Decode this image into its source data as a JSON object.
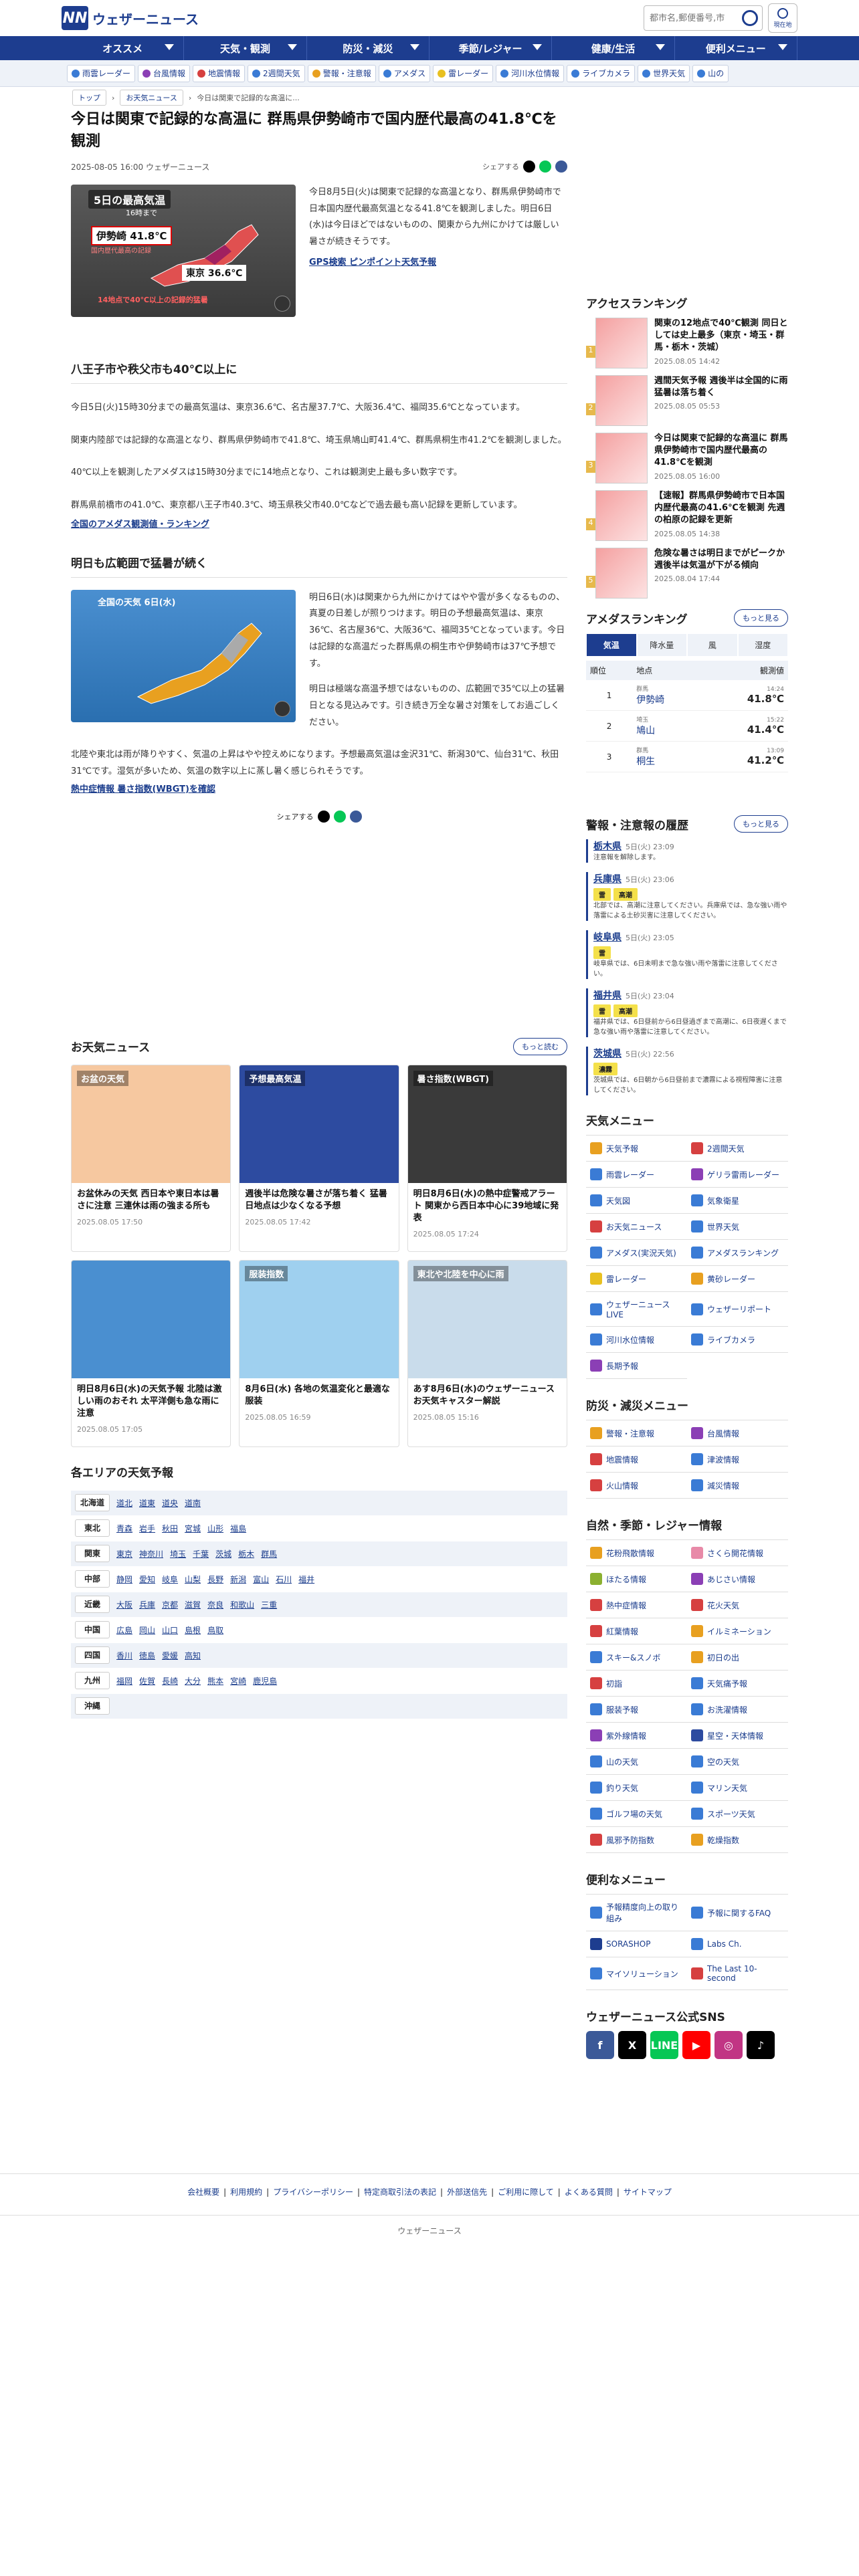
{
  "header": {
    "logo_mark": "NN",
    "logo_text": "ウェザーニュース",
    "search_placeholder": "都市名,郵便番号,市",
    "location_label": "現在地"
  },
  "gnav": [
    "オススメ",
    "天気・観測",
    "防災・減災",
    "季節/レジャー",
    "健康/生活",
    "便利メニュー"
  ],
  "subnav": [
    {
      "label": "雨雲レーダー",
      "color": "#3a7bd5"
    },
    {
      "label": "台風情報",
      "color": "#8b3fb5"
    },
    {
      "label": "地震情報",
      "color": "#d64040"
    },
    {
      "label": "2週間天気",
      "color": "#3a7bd5"
    },
    {
      "label": "警報・注意報",
      "color": "#e8a020"
    },
    {
      "label": "アメダス",
      "color": "#3a7bd5"
    },
    {
      "label": "雷レーダー",
      "color": "#e8c020"
    },
    {
      "label": "河川水位情報",
      "color": "#3a7bd5"
    },
    {
      "label": "ライブカメラ",
      "color": "#3a7bd5"
    },
    {
      "label": "世界天気",
      "color": "#3a7bd5"
    },
    {
      "label": "山の",
      "color": "#3a7bd5"
    }
  ],
  "breadcrumb": {
    "top": "トップ",
    "news": "お天気ニュース",
    "current": "今日は関東で記録的な高温に..."
  },
  "article": {
    "title": "今日は関東で記録的な高温に 群馬県伊勢崎市で国内歴代最高の41.8℃を観測",
    "date": "2025-08-05 16:00 ウェザーニュース",
    "share_label": "シェアする",
    "lead_image": {
      "heading": "5日の最高気温",
      "sub": "16時まで",
      "city": "伊勢崎 41.8℃",
      "note": "国内歴代最高の記録",
      "city2": "東京 36.6℃",
      "footer": "14地点で40℃以上の記録的猛暑"
    },
    "lead_text": "今日8月5日(火)は関東で記録的な高温となり、群馬県伊勢崎市で日本国内歴代最高気温となる41.8℃を観測しました。明日6日(水)は今日ほどではないものの、関東から九州にかけては厳しい暑さが続きそうです。",
    "gps_link": "GPS検索 ピンポイント天気予報",
    "h2_1": "八王子市や秩父市も40℃以上に",
    "p1": "今日5日(火)15時30分までの最高気温は、東京36.6℃、名古屋37.7℃、大阪36.4℃、福岡35.6℃となっています。",
    "p2": "関東内陸部では記録的な高温となり、群馬県伊勢崎市で41.8℃、埼玉県鳩山町41.4℃、群馬県桐生市41.2℃を観測しました。",
    "p3": "40℃以上を観測したアメダスは15時30分までに14地点となり、これは観測史上最も多い数字です。",
    "p4": "群馬県前橋市の41.0℃、東京都八王子市40.3℃、埼玉県秩父市40.0℃などで過去最も高い記録を更新しています。",
    "amedas_link": "全国のアメダス観測値・ランキング",
    "h2_2": "明日も広範囲で猛暑が続く",
    "image2": {
      "heading": "全国の天気 6日(水)"
    },
    "p5": "明日6日(水)は関東から九州にかけてはやや雲が多くなるものの、真夏の日差しが照りつけます。明日の予想最高気温は、東京36℃、名古屋36℃、大阪36℃、福岡35℃となっています。今日は記録的な高温だった群馬県の桐生市や伊勢崎市は37℃予想です。",
    "p6": "明日は極端な高温予想ではないものの、広範囲で35℃以上の猛暑日となる見込みです。引き続き万全な暑さ対策をしてお過ごしください。",
    "p7": "北陸や東北は雨が降りやすく、気温の上昇はやや控えめになります。予想最高気温は金沢31℃、新潟30℃、仙台31℃、秋田31℃です。湿気が多いため、気温の数字以上に蒸し暑く感じられそうです。",
    "wbgt_link": "熱中症情報 暑さ指数(WBGT)を確認"
  },
  "news_section": {
    "title": "お天気ニュース",
    "more": "もっと読む",
    "cards": [
      {
        "title": "お盆休みの天気 西日本や東日本は暑さに注意 三連休は雨の強まる所も",
        "date": "2025.08.05 17:50",
        "bg": "#f6c8a0",
        "img_label": "お盆の天気"
      },
      {
        "title": "週後半は危険な暑さが落ち着く 猛暑日地点は少なくなる予想",
        "date": "2025.08.05 17:42",
        "bg": "#2d4ba0",
        "img_label": "予想最高気温"
      },
      {
        "title": "明日8月6日(水)の熱中症警戒アラート 関東から西日本中心に39地域に発表",
        "date": "2025.08.05 17:24",
        "bg": "#3a3a3a",
        "img_label": "暑さ指数(WBGT)"
      },
      {
        "title": "明日8月6日(水)の天気予報 北陸は激しい雨のおそれ 太平洋側も急な雨に注意",
        "date": "2025.08.05 17:05",
        "bg": "#4a8fd0",
        "img_label": ""
      },
      {
        "title": "8月6日(水) 各地の気温変化と最適な服装",
        "date": "2025.08.05 16:59",
        "bg": "#9fd0ef",
        "img_label": "服装指数"
      },
      {
        "title": "あす8月6日(水)のウェザーニュース お天気キャスター解説",
        "date": "2025.08.05 15:16",
        "bg": "#c9dceb",
        "img_label": "東北や北陸を中心に雨"
      }
    ]
  },
  "area_section": {
    "title": "各エリアの天気予報",
    "rows": [
      {
        "region": "北海道",
        "prefs": [
          "道北",
          "道東",
          "道央",
          "道南"
        ]
      },
      {
        "region": "東北",
        "prefs": [
          "青森",
          "岩手",
          "秋田",
          "宮城",
          "山形",
          "福島"
        ]
      },
      {
        "region": "関東",
        "prefs": [
          "東京",
          "神奈川",
          "埼玉",
          "千葉",
          "茨城",
          "栃木",
          "群馬"
        ]
      },
      {
        "region": "中部",
        "prefs": [
          "静岡",
          "愛知",
          "岐阜",
          "山梨",
          "長野",
          "新潟",
          "富山",
          "石川",
          "福井"
        ]
      },
      {
        "region": "近畿",
        "prefs": [
          "大阪",
          "兵庫",
          "京都",
          "滋賀",
          "奈良",
          "和歌山",
          "三重"
        ]
      },
      {
        "region": "中国",
        "prefs": [
          "広島",
          "岡山",
          "山口",
          "島根",
          "鳥取"
        ]
      },
      {
        "region": "四国",
        "prefs": [
          "香川",
          "徳島",
          "愛媛",
          "高知"
        ]
      },
      {
        "region": "九州",
        "prefs": [
          "福岡",
          "佐賀",
          "長崎",
          "大分",
          "熊本",
          "宮崎",
          "鹿児島"
        ]
      },
      {
        "region": "沖縄",
        "prefs": []
      }
    ]
  },
  "sidebar": {
    "access_title": "アクセスランキング",
    "ranking": [
      {
        "n": "1",
        "title": "関東の12地点で40℃観測 同日としては史上最多（東京・埼玉・群馬・栃木・茨城）",
        "date": "2025.08.05 14:42"
      },
      {
        "n": "2",
        "title": "週間天気予報 週後半は全国的に雨 猛暑は落ち着く",
        "date": "2025.08.05 05:53"
      },
      {
        "n": "3",
        "title": "今日は関東で記録的な高温に 群馬県伊勢崎市で国内歴代最高の41.8℃を観測",
        "date": "2025.08.05 16:00"
      },
      {
        "n": "4",
        "title": "【速報】群馬県伊勢崎市で日本国内歴代最高の41.6℃を観測 先週の柏原の記録を更新",
        "date": "2025.08.05 14:38"
      },
      {
        "n": "5",
        "title": "危険な暑さは明日までがピークか 週後半は気温が下がる傾向",
        "date": "2025.08.04 17:44"
      }
    ],
    "amedas_title": "アメダスランキング",
    "amedas_more": "もっと見る",
    "amedas_tabs": [
      "気温",
      "降水量",
      "風",
      "湿度"
    ],
    "amedas_head": [
      "順位",
      "地点",
      "観測値"
    ],
    "amedas_rows": [
      {
        "n": "1",
        "pref": "群馬",
        "city": "伊勢崎",
        "time": "14:24",
        "val": "41.8℃"
      },
      {
        "n": "2",
        "pref": "埼玉",
        "city": "鳩山",
        "time": "15:22",
        "val": "41.4℃"
      },
      {
        "n": "3",
        "pref": "群馬",
        "city": "桐生",
        "time": "13:09",
        "val": "41.2℃"
      }
    ],
    "warn_title": "警報・注意報の履歴",
    "warn_more": "もっと見る",
    "warnings": [
      {
        "pref": "栃木県",
        "date": "5日(火) 23:09",
        "tags": [],
        "text": "注意報を解除します。"
      },
      {
        "pref": "兵庫県",
        "date": "5日(火) 23:06",
        "tags": [
          "雷",
          "高潮"
        ],
        "text": "北部では、高潮に注意してください。兵庫県では、急な強い雨や落雷による土砂災害に注意してください。"
      },
      {
        "pref": "岐阜県",
        "date": "5日(火) 23:05",
        "tags": [
          "雷"
        ],
        "text": "岐阜県では、6日未明まで急な強い雨や落雷に注意してください。"
      },
      {
        "pref": "福井県",
        "date": "5日(火) 23:04",
        "tags": [
          "雷",
          "高潮"
        ],
        "text": "福井県では、6日昼前から6日昼過ぎまで高潮に、6日夜遅くまで急な強い雨や落雷に注意してください。"
      },
      {
        "pref": "茨城県",
        "date": "5日(火) 22:56",
        "tags": [
          "濃霧"
        ],
        "text": "茨城県では、6日朝から6日昼前まで濃霧による視程障害に注意してください。"
      }
    ],
    "menu_title": "天気メニュー",
    "menu": [
      {
        "label": "天気予報",
        "c": "#e8a020"
      },
      {
        "label": "2週間天気",
        "c": "#d64040"
      },
      {
        "label": "雨雲レーダー",
        "c": "#3a7bd5"
      },
      {
        "label": "ゲリラ雷雨レーダー",
        "c": "#8b3fb5"
      },
      {
        "label": "天気図",
        "c": "#3a7bd5"
      },
      {
        "label": "気象衛星",
        "c": "#3a7bd5"
      },
      {
        "label": "お天気ニュース",
        "c": "#d64040"
      },
      {
        "label": "世界天気",
        "c": "#3a7bd5"
      },
      {
        "label": "アメダス(実況天気)",
        "c": "#3a7bd5"
      },
      {
        "label": "アメダスランキング",
        "c": "#3a7bd5"
      },
      {
        "label": "雷レーダー",
        "c": "#e8c020"
      },
      {
        "label": "黄砂レーダー",
        "c": "#e8a020"
      },
      {
        "label": "ウェザーニュースLIVE",
        "c": "#3a7bd5"
      },
      {
        "label": "ウェザーリポート",
        "c": "#3a7bd5"
      },
      {
        "label": "河川水位情報",
        "c": "#3a7bd5"
      },
      {
        "label": "ライブカメラ",
        "c": "#3a7bd5"
      },
      {
        "label": "長期予報",
        "c": "#8b3fb5"
      }
    ],
    "disaster_title": "防災・減災メニュー",
    "disaster": [
      {
        "label": "警報・注意報",
        "c": "#e8a020"
      },
      {
        "label": "台風情報",
        "c": "#8b3fb5"
      },
      {
        "label": "地震情報",
        "c": "#d64040"
      },
      {
        "label": "津波情報",
        "c": "#3a7bd5"
      },
      {
        "label": "火山情報",
        "c": "#d64040"
      },
      {
        "label": "減災情報",
        "c": "#3a7bd5"
      }
    ],
    "season_title": "自然・季節・レジャー情報",
    "season": [
      {
        "label": "花粉飛散情報",
        "c": "#e8a020"
      },
      {
        "label": "さくら開花情報",
        "c": "#e88aa8"
      },
      {
        "label": "ほたる情報",
        "c": "#8bb030"
      },
      {
        "label": "あじさい情報",
        "c": "#8b3fb5"
      },
      {
        "label": "熱中症情報",
        "c": "#d64040"
      },
      {
        "label": "花火天気",
        "c": "#d64040"
      },
      {
        "label": "紅葉情報",
        "c": "#d64040"
      },
      {
        "label": "イルミネーション",
        "c": "#e8a020"
      },
      {
        "label": "スキー&スノボ",
        "c": "#3a7bd5"
      },
      {
        "label": "初日の出",
        "c": "#e8a020"
      },
      {
        "label": "初詣",
        "c": "#d64040"
      },
      {
        "label": "天気痛予報",
        "c": "#3a7bd5"
      },
      {
        "label": "服装予報",
        "c": "#3a7bd5"
      },
      {
        "label": "お洗濯情報",
        "c": "#3a7bd5"
      },
      {
        "label": "紫外線情報",
        "c": "#8b3fb5"
      },
      {
        "label": "星空・天体情報",
        "c": "#2d4ba0"
      },
      {
        "label": "山の天気",
        "c": "#3a7bd5"
      },
      {
        "label": "空の天気",
        "c": "#3a7bd5"
      },
      {
        "label": "釣り天気",
        "c": "#3a7bd5"
      },
      {
        "label": "マリン天気",
        "c": "#3a7bd5"
      },
      {
        "label": "ゴルフ場の天気",
        "c": "#3a7bd5"
      },
      {
        "label": "スポーツ天気",
        "c": "#3a7bd5"
      },
      {
        "label": "風邪予防指数",
        "c": "#d64040"
      },
      {
        "label": "乾燥指数",
        "c": "#e8a020"
      }
    ],
    "useful_title": "便利なメニュー",
    "useful": [
      {
        "label": "予報精度向上の取り組み",
        "c": "#3a7bd5"
      },
      {
        "label": "予報に関するFAQ",
        "c": "#3a7bd5"
      },
      {
        "label": "SORASHOP",
        "c": "#1d3d8f"
      },
      {
        "label": "Labs Ch.",
        "c": "#3a7bd5"
      },
      {
        "label": "マイソリューション",
        "c": "#3a7bd5"
      },
      {
        "label": "The Last 10-second",
        "c": "#d64040"
      }
    ],
    "sns_title": "ウェザーニュース公式SNS",
    "sns": [
      {
        "label": "f",
        "c": "#3b5998"
      },
      {
        "label": "X",
        "c": "#000000"
      },
      {
        "label": "LINE",
        "c": "#06c755"
      },
      {
        "label": "▶",
        "c": "#ff0000"
      },
      {
        "label": "◎",
        "c": "#c13584"
      },
      {
        "label": "♪",
        "c": "#000000"
      }
    ]
  },
  "footer": {
    "links": [
      "会社概要",
      "利用規約",
      "プライバシーポリシー",
      "特定商取引法の表記",
      "外部送信先",
      "ご利用に際して",
      "よくある質問",
      "サイトマップ"
    ],
    "copy": "ウェザーニュース"
  }
}
